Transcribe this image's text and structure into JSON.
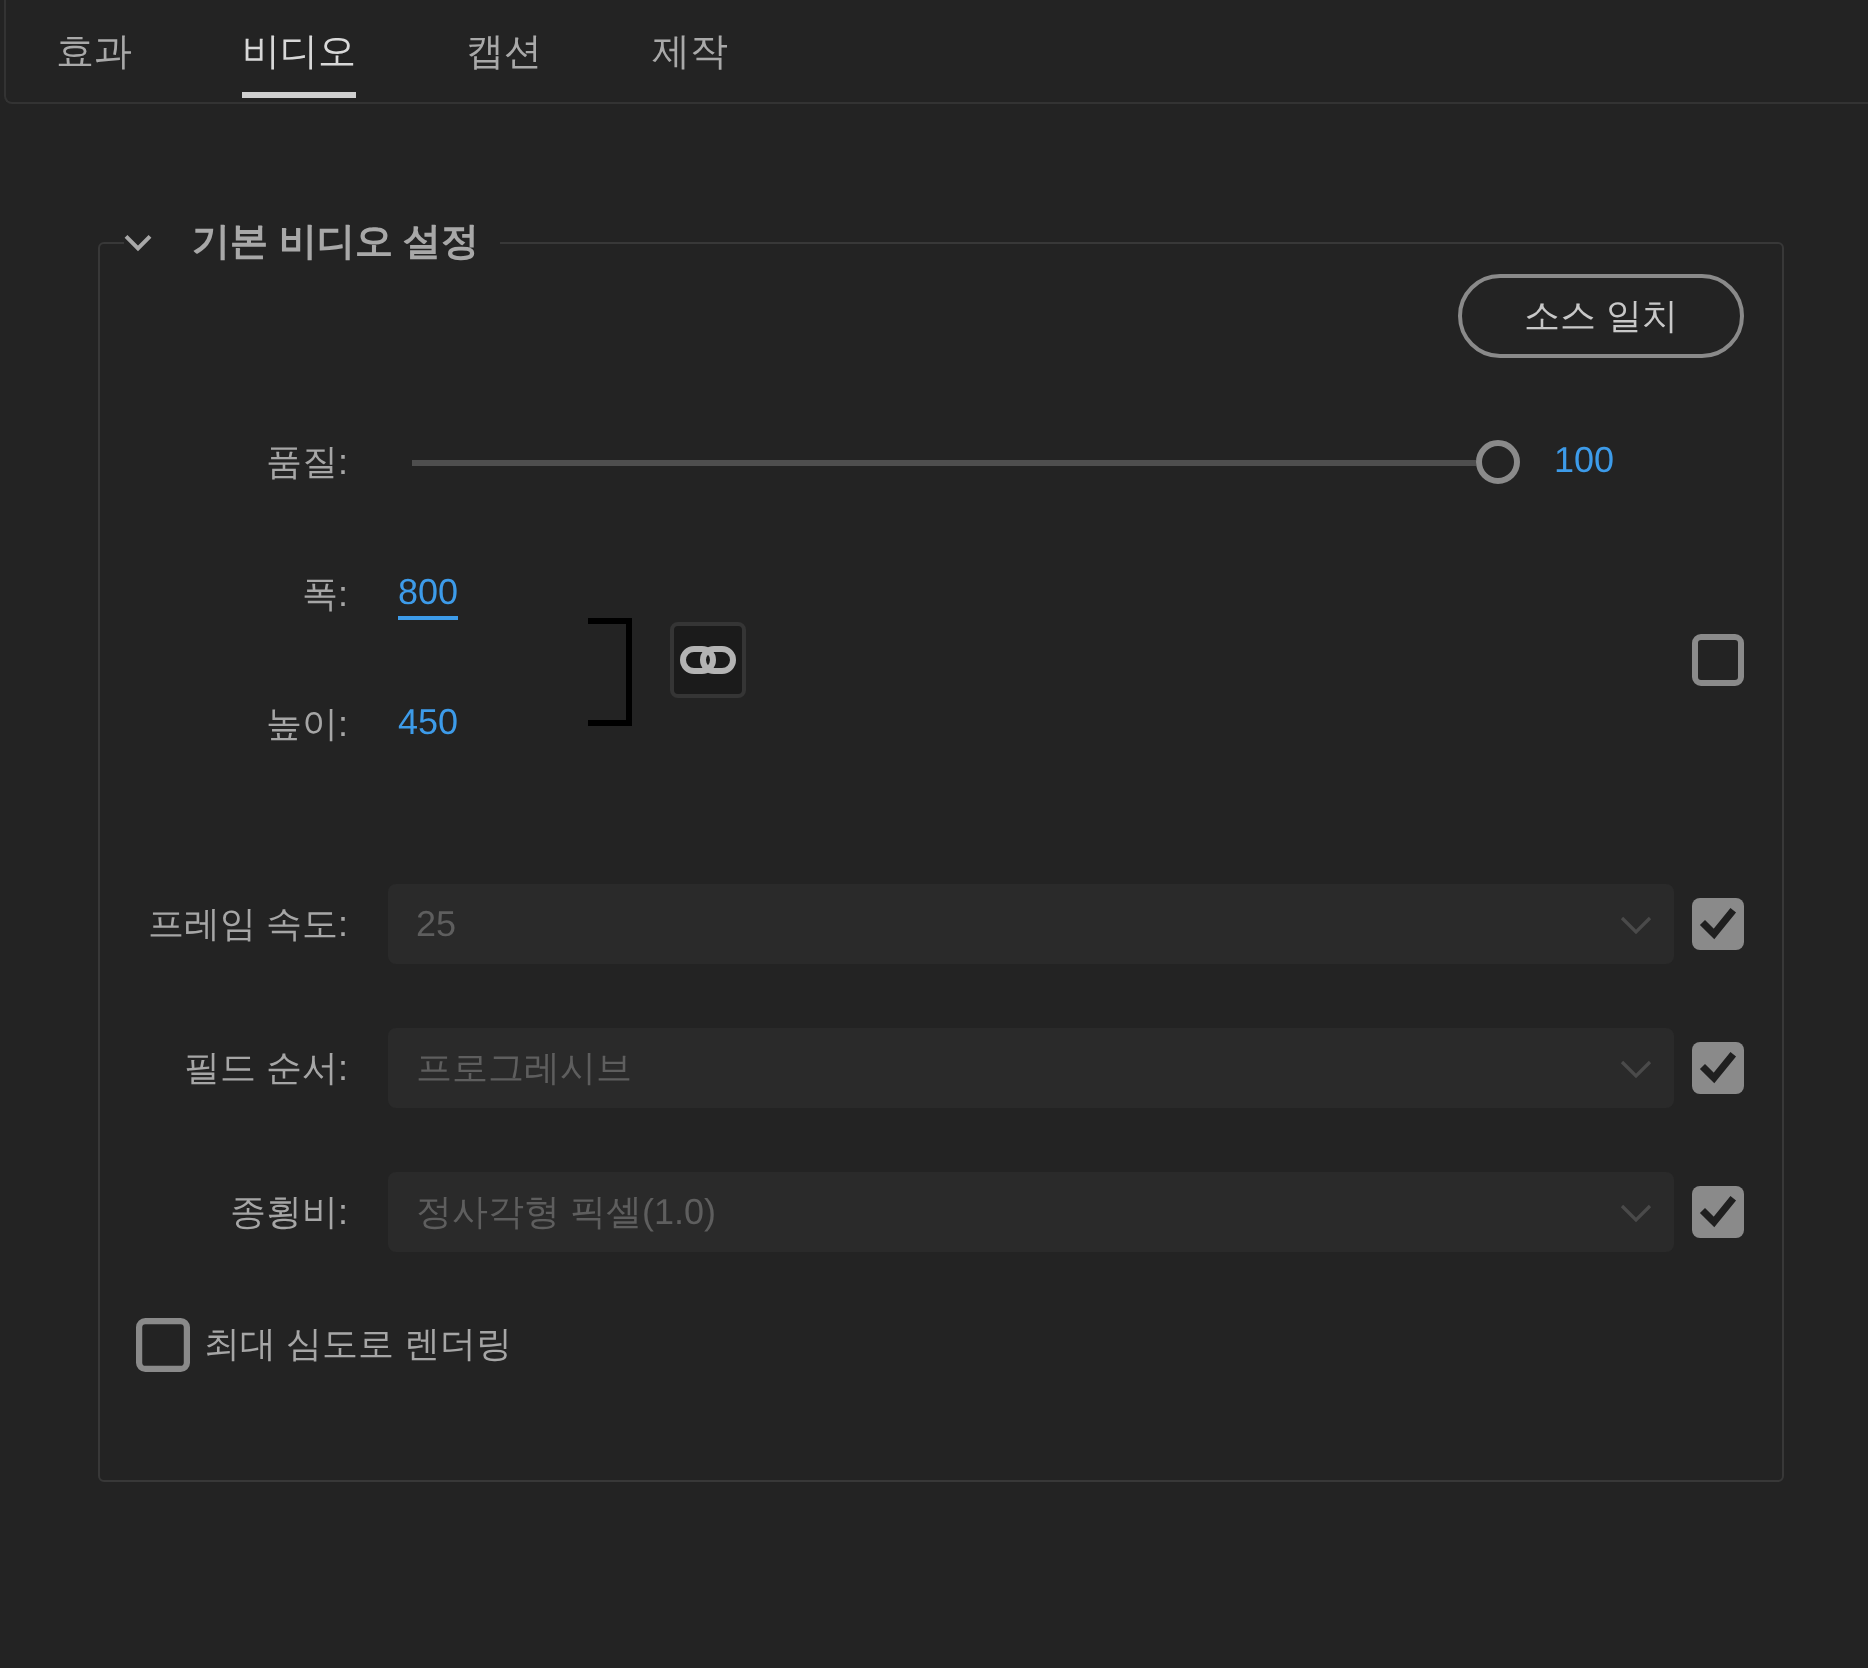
{
  "tabs": [
    {
      "label": "효과",
      "selected": false
    },
    {
      "label": "비디오",
      "selected": true
    },
    {
      "label": "캡션",
      "selected": false
    },
    {
      "label": "제작",
      "selected": false
    }
  ],
  "section": {
    "title": "기본 비디오 설정",
    "expanded": true,
    "match_source_button": "소스 일치",
    "quality": {
      "label": "품질:",
      "level": 1,
      "value": "100"
    },
    "frame_size": {
      "fields": [
        {
          "label": "폭:",
          "value": "800",
          "focused": true
        },
        {
          "label": "높이:",
          "value": "450",
          "focused": false
        }
      ],
      "match_source_checked": false
    },
    "dropdowns": [
      {
        "label": "프레임 속도:",
        "value": "25",
        "disabled": true,
        "checked": true
      },
      {
        "label": "필드 순서:",
        "value": "프로그레시브",
        "disabled": true,
        "checked": true
      },
      {
        "label": "종횡비:",
        "value": "정사각형 픽셀(1.0)",
        "disabled": true,
        "checked": true
      }
    ],
    "render_max_depth": {
      "label": "최대 심도로 렌더링",
      "checked": false
    }
  }
}
